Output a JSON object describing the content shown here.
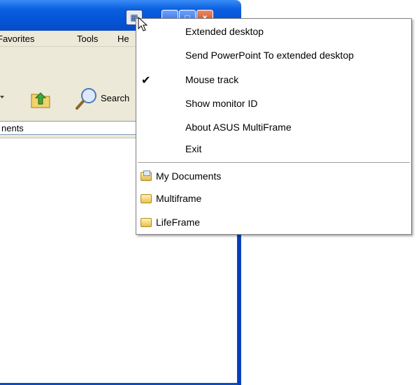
{
  "window": {
    "menubar": {
      "favorites": "Favorites",
      "tools": "Tools",
      "help": "He"
    },
    "toolbar": {
      "search_label": "Search"
    },
    "address": {
      "path_fragment": "nents"
    }
  },
  "titlebar": {
    "multiframe_glyph": "▦",
    "minimize_glyph": "‗",
    "maximize_glyph": "□",
    "close_glyph": "×"
  },
  "context_menu": {
    "items": [
      {
        "label": "Extended desktop",
        "checked": false
      },
      {
        "label": "Send PowerPoint To extended desktop",
        "checked": false
      },
      {
        "label": "Mouse track",
        "checked": true
      },
      {
        "label": "Show monitor ID",
        "checked": false
      },
      {
        "label": "About ASUS MultiFrame",
        "checked": false
      },
      {
        "label": "Exit",
        "checked": false
      }
    ],
    "check_glyph": "✔",
    "folders": [
      {
        "label": "My Documents",
        "icon": "my-documents-icon"
      },
      {
        "label": "Multiframe",
        "icon": "folder-icon"
      },
      {
        "label": "LifeFrame",
        "icon": "folder-icon"
      }
    ]
  }
}
